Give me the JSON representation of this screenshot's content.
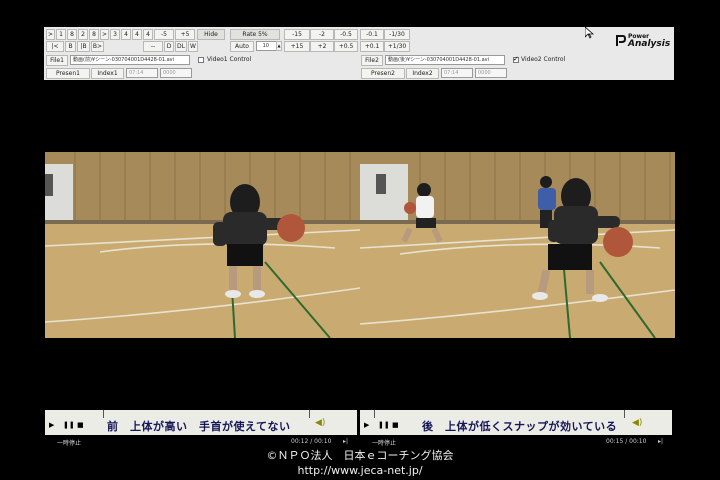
{
  "toolbar": {
    "row1_left": [
      ">",
      "1",
      "8",
      "2",
      "8",
      ">",
      "3",
      "4",
      "4",
      "4",
      "-5",
      "+5"
    ],
    "row2_left": [
      "|<",
      "B",
      "|B",
      "B>",
      "--",
      "D",
      "DL",
      "W"
    ],
    "hide_label": "Hide",
    "rate_label": "Rate 5%",
    "auto_label": "Auto",
    "frame_value": "10",
    "steps_row1": [
      "-15",
      "-2",
      "-0.5",
      "-0.1",
      "-1/30"
    ],
    "steps_row2": [
      "+15",
      "+2",
      "+0.5",
      "+0.1",
      "+1/30"
    ],
    "file1_label": "File1",
    "file1_path": "動画(前)¥シーン-030704001D4428-01.avi",
    "video1_control": "Video1 Control",
    "file2_label": "File2",
    "file2_path": "動画(後)¥シーン-030704001D4428-01.avi",
    "video2_control": "Video2 Control",
    "presen1": "Presen1",
    "index1": "Index1",
    "presen2": "Presen2",
    "index2": "Index2",
    "time1_value": "07:14",
    "time1_extra": "0000",
    "time2_value": "07:14",
    "time2_extra": "0000",
    "logo_line1": "Power",
    "logo_line2": "Analysis"
  },
  "player_left": {
    "caption": "前　上体が高い　手首が使えてない",
    "status": "一時停止",
    "time": "00:12 / 00:10"
  },
  "player_right": {
    "caption": "後　上体が低くスナップが効いている",
    "status": "一時停止",
    "time": "00:15 / 00:10"
  },
  "footer": {
    "copyright": "©ＮＰＯ法人　日本ｅコーチング協会",
    "url": "http://www.jeca-net.jp/"
  },
  "colors": {
    "panel_bg": "#e9e9ea",
    "caption_text": "#151557",
    "gym_wall": "#a68a5a",
    "gym_floor": "#c9ab72"
  }
}
